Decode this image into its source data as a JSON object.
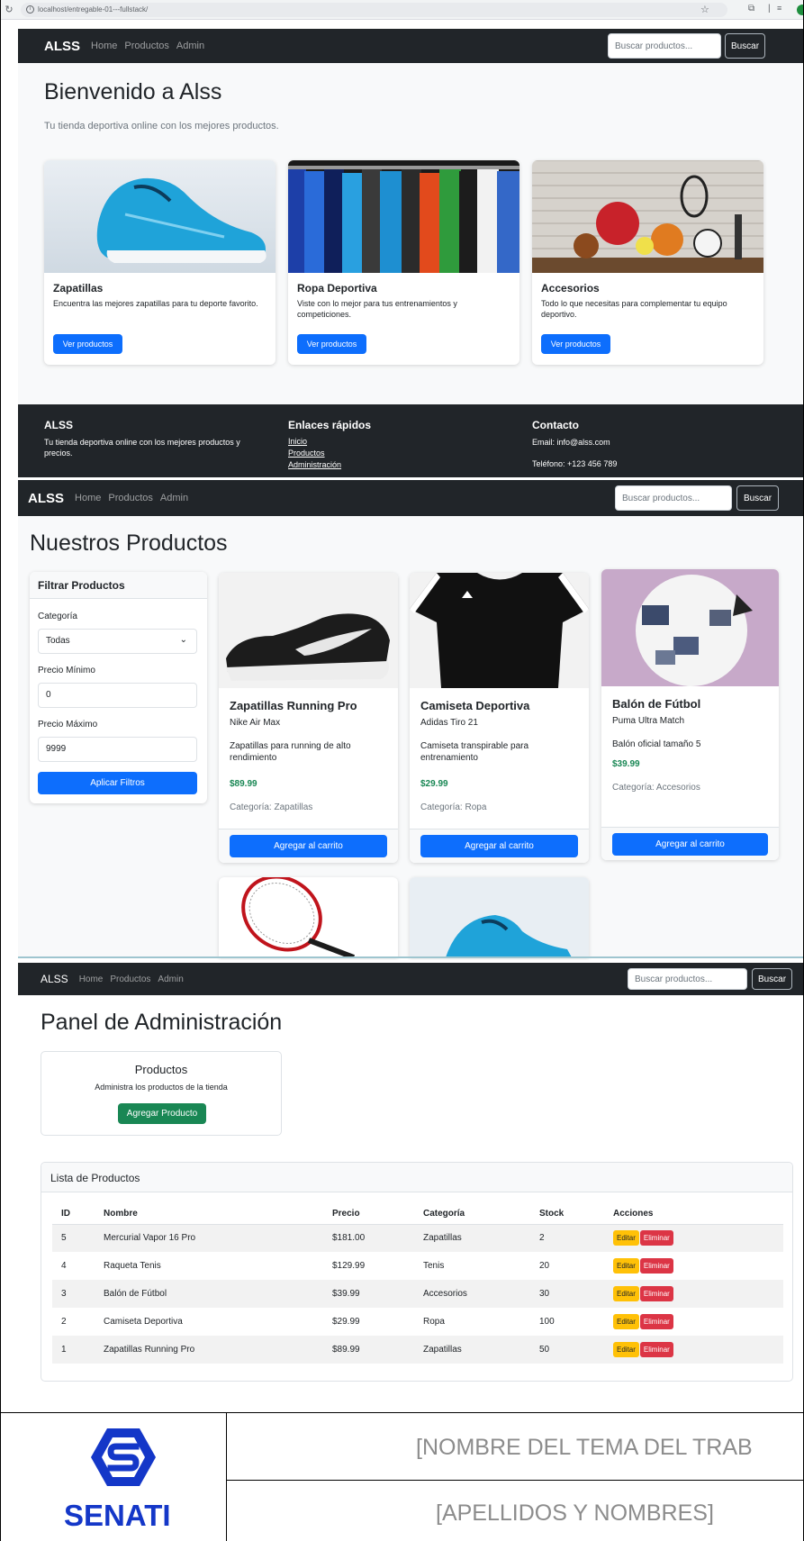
{
  "browser": {
    "url": "localhost/entregable-01---fullstack/"
  },
  "nav": {
    "brand": "ALSS",
    "home": "Home",
    "productos": "Productos",
    "admin": "Admin",
    "search_placeholder": "Buscar productos...",
    "search_button": "Buscar"
  },
  "home": {
    "title": "Bienvenido a Alss",
    "lead": "Tu tienda deportiva online con los mejores productos.",
    "cards": [
      {
        "title": "Zapatillas",
        "text": "Encuentra las mejores zapatillas para tu deporte favorito.",
        "button": "Ver productos"
      },
      {
        "title": "Ropa Deportiva",
        "text": "Viste con lo mejor para tus entrenamientos y competiciones.",
        "button": "Ver productos"
      },
      {
        "title": "Accesorios",
        "text": "Todo lo que necesitas para complementar tu equipo deportivo.",
        "button": "Ver productos"
      }
    ]
  },
  "footer": {
    "brand_title": "ALSS",
    "brand_text": "Tu tienda deportiva online con los mejores productos y precios.",
    "links_title": "Enlaces rápidos",
    "links": [
      "Inicio",
      "Productos",
      "Administración"
    ],
    "contact_title": "Contacto",
    "email": "Email: info@alss.com",
    "phone": "Teléfono: +123 456 789"
  },
  "products_page": {
    "title": "Nuestros Productos",
    "filter": {
      "title": "Filtrar Productos",
      "category_label": "Categoría",
      "category_value": "Todas",
      "min_label": "Precio Mínimo",
      "min_value": "0",
      "max_label": "Precio Máximo",
      "max_value": "9999",
      "apply": "Aplicar Filtros"
    },
    "products": [
      {
        "name": "Zapatillas Running Pro",
        "brand": "Nike Air Max",
        "desc": "Zapatillas para running de alto rendimiento",
        "price": "$89.99",
        "category": "Categoría: Zapatillas",
        "button": "Agregar al carrito"
      },
      {
        "name": "Camiseta Deportiva",
        "brand": "Adidas Tiro 21",
        "desc": "Camiseta transpirable para entrenamiento",
        "price": "$29.99",
        "category": "Categoría: Ropa",
        "button": "Agregar al carrito"
      },
      {
        "name": "Balón de Fútbol",
        "brand": "Puma Ultra Match",
        "desc": "Balón oficial tamaño 5",
        "price": "$39.99",
        "category": "Categoría: Accesorios",
        "button": "Agregar al carrito"
      }
    ]
  },
  "admin": {
    "title": "Panel de Administración",
    "card_title": "Productos",
    "card_text": "Administra los productos de la tienda",
    "add_button": "Agregar Producto",
    "list_title": "Lista de Productos",
    "columns": [
      "ID",
      "Nombre",
      "Precio",
      "Categoría",
      "Stock",
      "Acciones"
    ],
    "rows": [
      [
        "5",
        "Mercurial Vapor 16 Pro",
        "$181.00",
        "Zapatillas",
        "2"
      ],
      [
        "4",
        "Raqueta Tenis",
        "$129.99",
        "Tenis",
        "20"
      ],
      [
        "3",
        "Balón de Fútbol",
        "$39.99",
        "Accesorios",
        "30"
      ],
      [
        "2",
        "Camiseta Deportiva",
        "$29.99",
        "Ropa",
        "100"
      ],
      [
        "1",
        "Zapatillas Running Pro",
        "$89.99",
        "Zapatillas",
        "50"
      ]
    ],
    "edit_label": "Editar",
    "delete_label": "Eliminar"
  },
  "doc_footer": {
    "logo_text": "SENATI",
    "topic": "[NOMBRE DEL TEMA DEL TRAB",
    "names": "[APELLIDOS Y NOMBRES]"
  },
  "colors": {
    "primary": "#0d6efd",
    "success": "#198754",
    "warning": "#ffc107",
    "danger": "#dc3545",
    "dark": "#212529",
    "senati_blue": "#1437c8"
  }
}
